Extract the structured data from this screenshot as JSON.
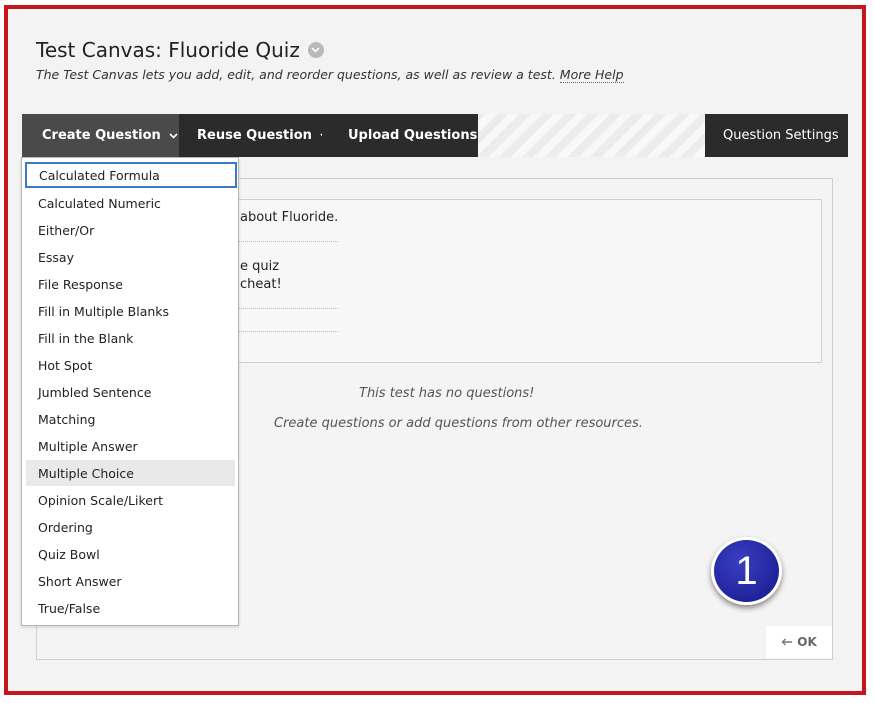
{
  "header": {
    "title": "Test Canvas: Fluoride Quiz",
    "subtitle": "The Test Canvas lets you add, edit, and reorder questions, as well as review a test.",
    "more_help": "More Help"
  },
  "toolbar": {
    "create_question": "Create Question",
    "reuse_question": "Reuse Question",
    "upload_questions": "Upload Questions",
    "question_settings": "Question Settings"
  },
  "dropdown": {
    "items": [
      "Calculated Formula",
      "Calculated Numeric",
      "Either/Or",
      "Essay",
      "File Response",
      "Fill in Multiple Blanks",
      "Fill in the Blank",
      "Hot Spot",
      "Jumbled Sentence",
      "Matching",
      "Multiple Answer",
      "Multiple Choice",
      "Opinion Scale/Likert",
      "Ordering",
      "Quiz Bowl",
      "Short Answer",
      "True/False"
    ],
    "focused_item": "Calculated Formula",
    "hovered_item": "Multiple Choice"
  },
  "info_box": {
    "line1": "about Fluoride.",
    "line2": "e quiz",
    "line3": "cheat!"
  },
  "empty_state": {
    "message": "This test has no questions!",
    "hint": "Create questions or add questions from other resources."
  },
  "callout": {
    "number": "1"
  },
  "ok_button": {
    "label": "OK"
  },
  "colors": {
    "frame_border": "#c4161c",
    "toolbar_dark": "#2b2b2b",
    "toolbar_active": "#4a4a4a",
    "focus_outline": "#3a7bc8",
    "callout_blue": "#1f239a"
  }
}
